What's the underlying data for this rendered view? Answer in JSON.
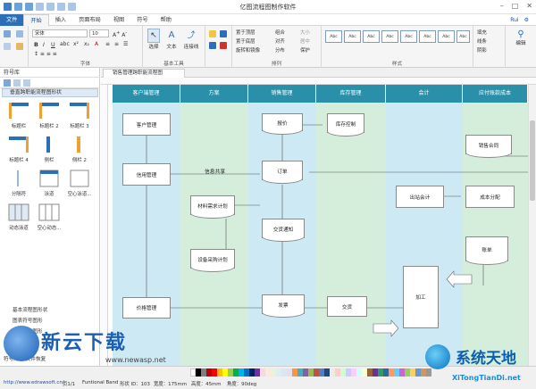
{
  "app": {
    "title": "亿图流程图制作软件"
  },
  "menu": {
    "file": "文件",
    "items": [
      "开始",
      "插入",
      "页面布局",
      "视图",
      "符号",
      "帮助"
    ],
    "right_user": "Rui",
    "right_settings": "⚙"
  },
  "ribbon": {
    "font": {
      "family": "宋体",
      "size": "10",
      "group_label": "字体"
    },
    "tools": {
      "select": "选择",
      "text": "文本",
      "connector": "连接线",
      "group_label": "基本工具"
    },
    "arrange": {
      "items": [
        "置于顶层",
        "置于底层",
        "旋转和镜像",
        "组合",
        "对齐",
        "分布",
        "大小",
        "居中",
        "保护"
      ],
      "group_label": "排列"
    },
    "styles": {
      "boxes": [
        "Abc",
        "Abc",
        "Abc",
        "Abc",
        "Abc",
        "Abc",
        "Abc",
        "Abc"
      ],
      "group_label": "样式"
    },
    "fill": {
      "items": [
        "填充",
        "线条",
        "阴影"
      ]
    },
    "edit": {
      "label": "编辑"
    }
  },
  "sidebar": {
    "header": "符号库",
    "library_name": "垂直跨职能流程图形状",
    "shapes": [
      "标题栏",
      "标题栏 2",
      "标题栏 3",
      "标题栏 4",
      "侧栏",
      "侧栏 2",
      "分隔符",
      "泳道",
      "空心泳道...",
      "动态泳道",
      "空心动态..."
    ],
    "libraries": [
      "基本流程图形状",
      "图表符号图形",
      "组织结构图形",
      "文本框形状"
    ],
    "bottom_tabs": [
      "符号库",
      "文件恢复"
    ]
  },
  "document": {
    "tab_title": "销售管理跨职能流程图"
  },
  "diagram": {
    "lanes": [
      "客户端管理",
      "方案",
      "销售管理",
      "库存管理",
      "会计",
      "应付账款成本"
    ],
    "nodes": {
      "customer_mgmt": "客户管理",
      "credit_mgmt": "信用管理",
      "price_mgmt": "价格管理",
      "info_share": "信息共享",
      "material_plan": "材料需求计划",
      "purchase_plan": "设备采购计划",
      "quote": "报价",
      "order": "订单",
      "delivery_notice": "交货通知",
      "ship": "发票",
      "inventory_ctrl": "库存控制",
      "delivery": "交货",
      "out_accounting": "出站会计",
      "sales_contract": "销售合同",
      "cost_alloc": "成本分配",
      "ledger": "账单",
      "process": "加工"
    }
  },
  "status": {
    "url": "http://www.edrawsoft.cn/",
    "page": "页1/1",
    "shape": "Funtional Band",
    "shape_id": "形状 ID：103",
    "width": "宽度：175mm",
    "height": "高度：45mm",
    "angle": "角度：90deg"
  },
  "watermark": {
    "left_brand": "新云下载",
    "left_url": "www.newasp.net",
    "right_brand": "系统天地",
    "right_url": "XiTongTianDi.net"
  },
  "colors": {
    "lane_header": "#2a8fa8",
    "lane_green": "#d4eedb",
    "lane_blue": "#cde9f4",
    "accent": "#2d6fb7"
  }
}
